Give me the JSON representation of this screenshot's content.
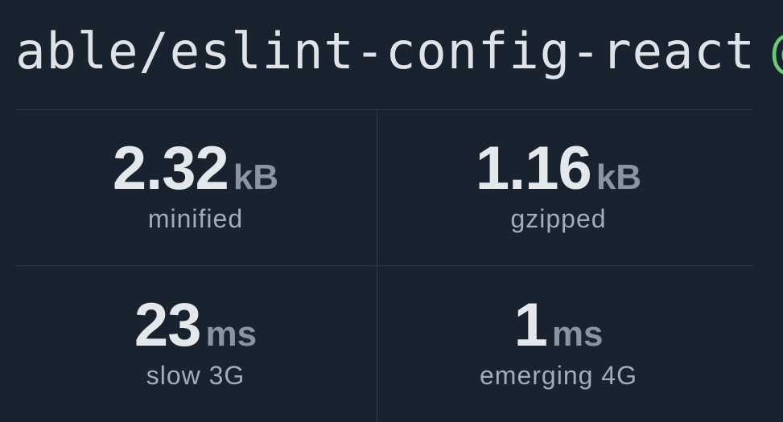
{
  "package": {
    "name_visible": "able/eslint-config-react",
    "at_symbol": "@"
  },
  "stats": [
    {
      "value": "2.32",
      "unit": "kB",
      "label": "minified"
    },
    {
      "value": "1.16",
      "unit": "kB",
      "label": "gzipped"
    },
    {
      "value": "23",
      "unit": "ms",
      "label": "slow 3G"
    },
    {
      "value": "1",
      "unit": "ms",
      "label": "emerging 4G"
    }
  ],
  "colors": {
    "background": "#19232f",
    "value": "#e4e7eb",
    "unit": "#8a95a3",
    "label": "#a3acb7",
    "divider": "#2c3846",
    "accent_green": "#6ec87a"
  }
}
